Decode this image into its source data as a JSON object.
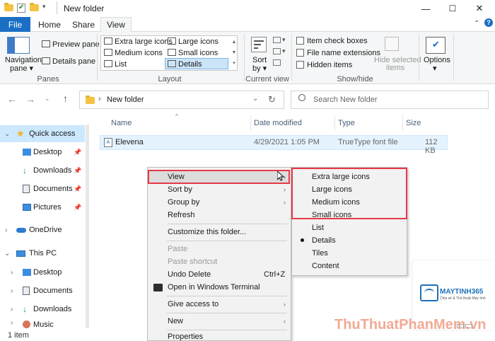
{
  "window": {
    "title": "New folder",
    "controls": {
      "minimize": "—",
      "maximize": "☐",
      "close": "✕"
    }
  },
  "ribbon_tabs": [
    "File",
    "Home",
    "Share",
    "View"
  ],
  "ribbon": {
    "panes": {
      "navigation_pane": "Navigation",
      "navigation_pane_2": "pane ▾",
      "preview_pane": "Preview pane",
      "details_pane": "Details pane",
      "label": "Panes"
    },
    "layout": {
      "items": [
        "Extra large icons",
        "Large icons",
        "Medium icons",
        "Small icons",
        "List",
        "Details"
      ],
      "selected": "Details",
      "label": "Layout"
    },
    "current_view": {
      "sort_by": "Sort",
      "sort_by_2": "by ▾",
      "label": "Current view"
    },
    "show_hide": {
      "item_check_boxes": "Item check boxes",
      "file_name_extensions": "File name extensions",
      "hidden_items": "Hidden items",
      "hide_selected_1": "Hide selected",
      "hide_selected_2": "items",
      "label": "Show/hide"
    },
    "options": {
      "label": "Options",
      "label_2": "▾"
    }
  },
  "address": {
    "path": "New folder",
    "search_placeholder": "Search New folder"
  },
  "nav_pane": {
    "items": [
      {
        "label": "Quick access",
        "expanded": true
      },
      {
        "label": "Desktop",
        "pinned": true
      },
      {
        "label": "Downloads",
        "pinned": true
      },
      {
        "label": "Documents",
        "pinned": true
      },
      {
        "label": "Pictures",
        "pinned": true
      },
      {
        "label": "OneDrive"
      },
      {
        "label": "This PC",
        "expanded": true
      },
      {
        "label": "Desktop"
      },
      {
        "label": "Documents"
      },
      {
        "label": "Downloads"
      },
      {
        "label": "Music"
      }
    ]
  },
  "columns": [
    "Name",
    "Date modified",
    "Type",
    "Size"
  ],
  "files": [
    {
      "name": "Elevena",
      "date_modified": "4/29/2021 1:05 PM",
      "type": "TrueType font file",
      "size": "112 KB"
    }
  ],
  "context_menu": {
    "items": [
      {
        "label": "View",
        "submenu": true
      },
      {
        "label": "Sort by",
        "submenu": true
      },
      {
        "label": "Group by",
        "submenu": true
      },
      {
        "label": "Refresh"
      },
      {
        "label": "Customize this folder..."
      },
      {
        "label": "Paste",
        "disabled": true
      },
      {
        "label": "Paste shortcut",
        "disabled": true
      },
      {
        "label": "Undo Delete",
        "shortcut": "Ctrl+Z"
      },
      {
        "label": "Open in Windows Terminal"
      },
      {
        "label": "Give access to",
        "submenu": true
      },
      {
        "label": "New",
        "submenu": true
      },
      {
        "label": "Properties"
      }
    ]
  },
  "view_submenu": {
    "items": [
      "Extra large icons",
      "Large icons",
      "Medium icons",
      "Small icons",
      "List",
      "Details",
      "Tiles",
      "Content"
    ],
    "checked": "Details"
  },
  "status": {
    "item_count": "1 item"
  },
  "watermark": {
    "logo_text": "MAYTINH365",
    "logo_sub": "Chia sẻ & Thủ thuật Máy tính",
    "site": "ThuThuatPhanMem.vn"
  },
  "colors": {
    "accent": "#1a6fc4",
    "highlight": "#cce4f7",
    "annotation_red": "#e63946"
  }
}
